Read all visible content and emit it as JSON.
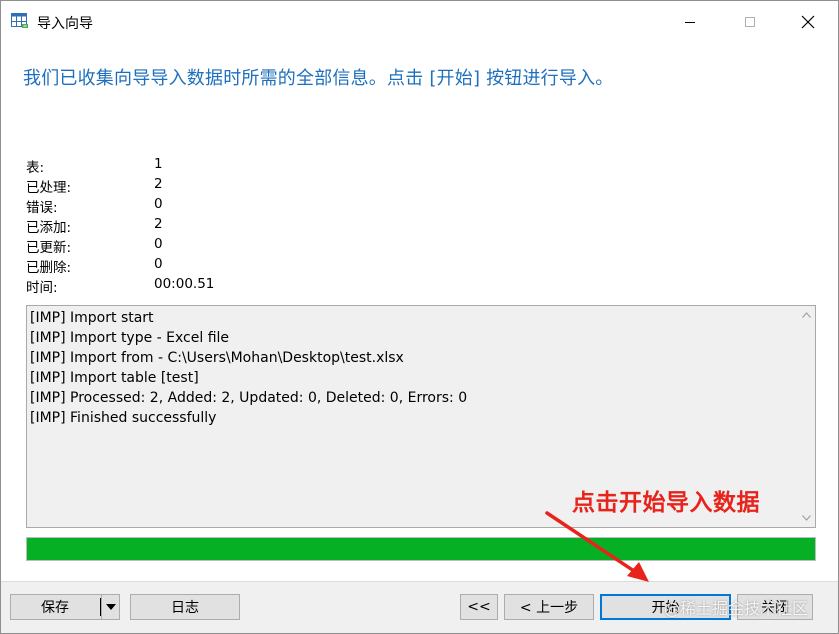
{
  "window": {
    "title": "导入向导"
  },
  "heading": "我们已收集向导导入数据时所需的全部信息。点击 [开始] 按钮进行导入。",
  "stats": [
    {
      "label": "表:",
      "value": "1"
    },
    {
      "label": "已处理:",
      "value": "2"
    },
    {
      "label": "错误:",
      "value": "0"
    },
    {
      "label": "已添加:",
      "value": "2"
    },
    {
      "label": "已更新:",
      "value": "0"
    },
    {
      "label": "已删除:",
      "value": "0"
    },
    {
      "label": "时间:",
      "value": "00:00.51"
    }
  ],
  "log": [
    "[IMP] Import start",
    "[IMP] Import type - Excel file",
    "[IMP] Import from - C:\\Users\\Mohan\\Desktop\\test.xlsx",
    "[IMP] Import table [test]",
    "[IMP] Processed: 2, Added: 2, Updated: 0, Deleted: 0, Errors: 0",
    "[IMP] Finished successfully"
  ],
  "progress": {
    "percent": 100,
    "color": "#06b025"
  },
  "buttons": {
    "save": "保存",
    "log": "日志",
    "first": "<<",
    "prev": "< 上一步",
    "start": "开始",
    "close": "关闭"
  },
  "annotation": {
    "text": "点击开始导入数据",
    "color": "#e8231b"
  },
  "watermark": "@稀土掘金技术社区",
  "colors": {
    "heading": "#1e6fbd",
    "accent": "#0078d7"
  }
}
